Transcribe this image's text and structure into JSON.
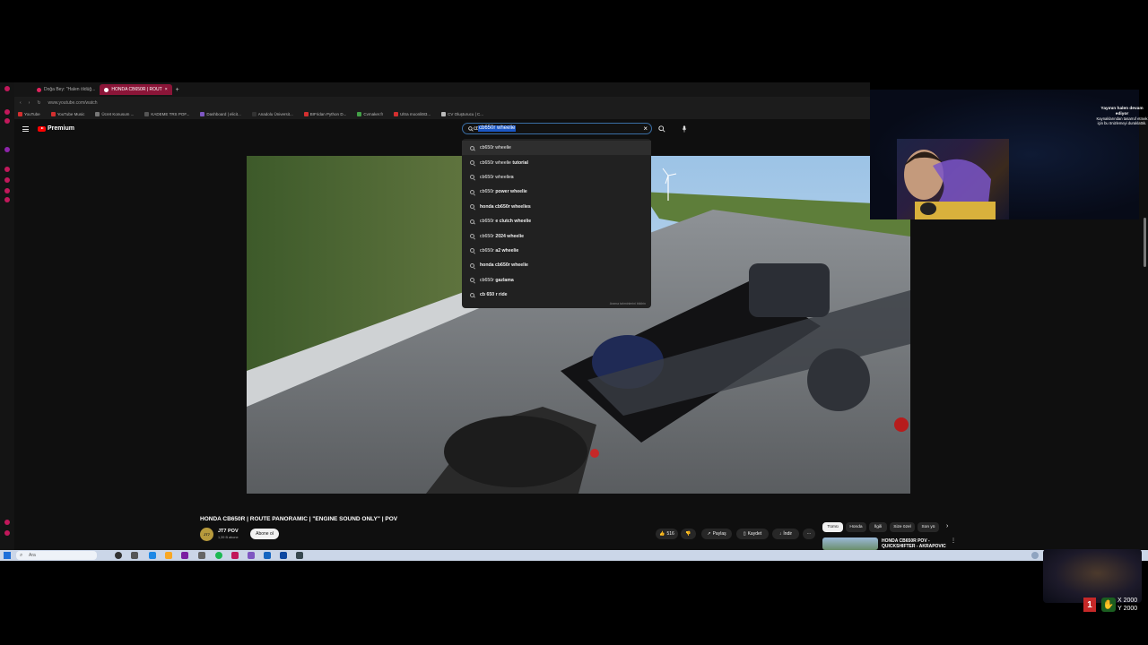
{
  "tabs": [
    {
      "label": "Doğa Bey: \"Halen öldüğ...",
      "active": false
    },
    {
      "label": "HONDA CB650R | ROUT",
      "active": true
    }
  ],
  "address": "www.youtube.com/watch",
  "bookmarks": [
    "YouTube",
    "YouTube Music",
    "Ücret Konusum ...",
    "KADEME TRS POF...",
    "Dashboard | elicit...",
    "Anadolu Üniversit...",
    "BIFridan Python D...",
    "Cvmaker.fr",
    "Ultra moonlit83...",
    "CV Oluşturucu | C..."
  ],
  "youtube": {
    "logo_text": "Premium",
    "search_value": "cb650r wheelie",
    "suggestions": [
      {
        "plain": "cb650r wheelie",
        "bold": ""
      },
      {
        "plain": "cb650r wheelie",
        "bold": " tutorial"
      },
      {
        "plain": "cb650r wheelie",
        "bold": "s"
      },
      {
        "plain": "cb650r ",
        "bold": "power wheelie"
      },
      {
        "plain": "",
        "bold": "honda cb650r wheelies"
      },
      {
        "plain": "cb650r ",
        "bold": "e clutch wheelie"
      },
      {
        "plain": "cb650r ",
        "bold": "2024 wheelie"
      },
      {
        "plain": "cb650r ",
        "bold": "a2 wheelie"
      },
      {
        "plain": "",
        "bold": "honda cb650r wheelie"
      },
      {
        "plain": "cb650r ",
        "bold": "gazlama"
      },
      {
        "plain": "",
        "bold": "cb 650 r ride"
      }
    ],
    "report_label": "Arama tahminlerini bildirin",
    "video_title": "HONDA CB650R | ROUTE PANORAMIC | \"ENGINE SOUND ONLY\" | POV",
    "channel_avatar": "JT7",
    "channel_name": "JT7 POV",
    "channel_subs": "1,39 B abone",
    "subscribe_label": "Abone ol",
    "like_count": "516",
    "share_label": "Paylaş",
    "save_label": "Kaydet",
    "download_label": "İndir",
    "more_label": "···",
    "chips": [
      "Tümü",
      "Honda",
      "İlgili",
      "Size özel",
      "Son yü"
    ],
    "next_video_title": "HONDA CB650R POV - QUICKSHIFTER - AKRAPOVIC"
  },
  "taskbar": {
    "search_placeholder": "Ara"
  },
  "stream": {
    "notice_title": "Yayının halen devam ediyor",
    "notice_body": "Kaynaklarından tasarruf etmek için bu önizlemeyi duraklattık.",
    "badge": "1",
    "coord_x": "X 2000",
    "coord_y": "Y 2000"
  }
}
